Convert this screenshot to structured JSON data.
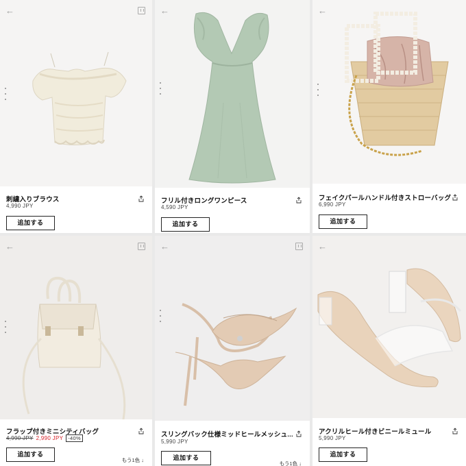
{
  "products": [
    {
      "name": "刺繍入りブラウス",
      "price": "4,990 JPY",
      "add_label": "追加する"
    },
    {
      "name": "フリル付きロングワンピース",
      "price": "4,590 JPY",
      "add_label": "追加する"
    },
    {
      "name": "フェイクパールハンドル付きストローバッグ",
      "price": "6,990 JPY",
      "add_label": "追加する"
    },
    {
      "name": "フラップ付きミニシティバッグ",
      "old_price": "4,990 JPY",
      "new_price": "2,990 JPY",
      "discount": "-40%",
      "add_label": "追加する",
      "more_label": "もう1色 ↓"
    },
    {
      "name": "スリングバック仕様ミッドヒールメッシュ...",
      "price": "5,990 JPY",
      "add_label": "追加する",
      "more_label": "もう1色 ↓"
    },
    {
      "name": "アクリルヒール付きビニールミュール",
      "price": "5,990 JPY",
      "add_label": "追加する"
    }
  ],
  "icons": {
    "back": "back-arrow-icon",
    "save": "save-icon",
    "share": "share-icon"
  },
  "colors": {
    "sale_price": "#d8232a",
    "text": "#111111"
  }
}
